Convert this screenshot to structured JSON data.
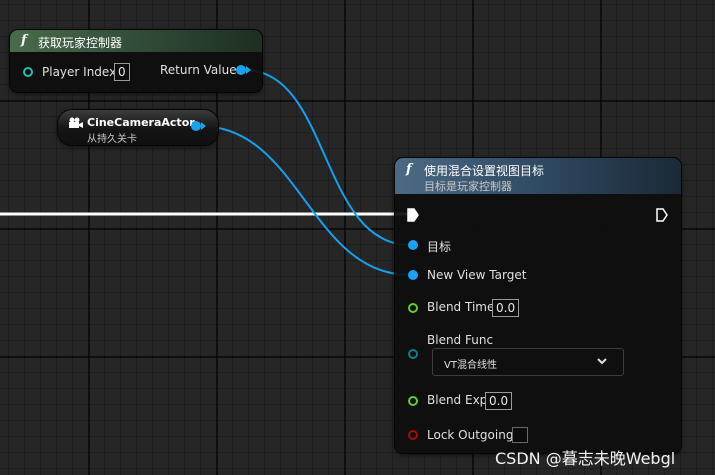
{
  "node_get_controller": {
    "title": "获取玩家控制器",
    "player_index_label": "Player Index",
    "player_index_value": "0",
    "return_value_label": "Return Value"
  },
  "node_camera": {
    "title": "CineCameraActor",
    "subtitle": "从持久关卡"
  },
  "node_set_view_target": {
    "title": "使用混合设置视图目标",
    "subtitle": "目标是玩家控制器",
    "target_label": "目标",
    "new_view_target_label": "New View Target",
    "blend_time_label": "Blend Time",
    "blend_time_value": "0.0",
    "blend_func_label": "Blend Func",
    "blend_func_value": "VT混合线性",
    "blend_exp_label": "Blend Exp",
    "blend_exp_value": "0.0",
    "lock_outgoing_label": "Lock Outgoing",
    "lock_outgoing_checked": false
  },
  "watermark": "CSDN @暮志未晚Webgl",
  "colors": {
    "object_pin": "#17a3f2",
    "float_pin": "#5fcf2a",
    "int_pin": "#1fc0a6",
    "bool_pin": "#a30e0e",
    "enum_pin": "#0e7f84",
    "function_header_green": "#3b5a3c",
    "function_header_blue": "#3c5670"
  }
}
